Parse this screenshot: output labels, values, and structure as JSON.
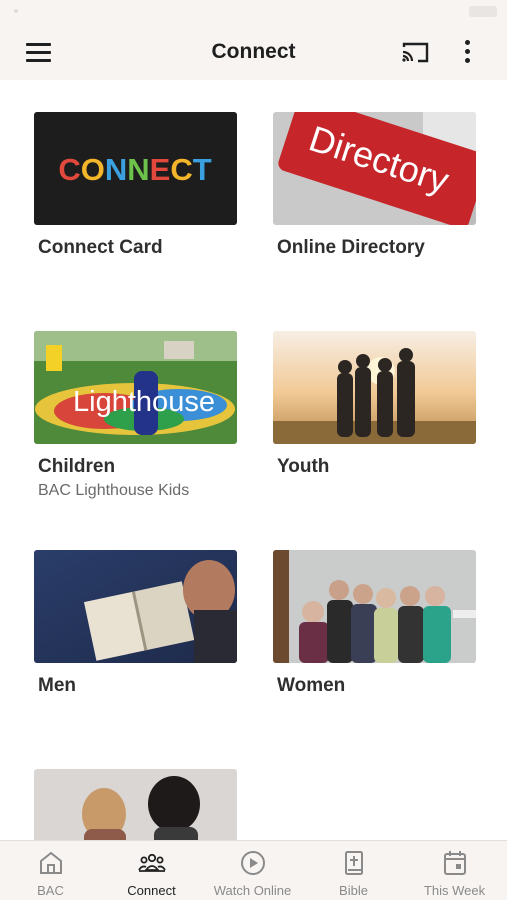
{
  "header": {
    "title": "Connect"
  },
  "cards": [
    {
      "label": "Connect Card",
      "image_text": "CONNECT"
    },
    {
      "label": "Online Directory",
      "image_text": "Directory"
    },
    {
      "label": "Children",
      "subtitle": "BAC Lighthouse Kids",
      "image_text": "Lighthouse"
    },
    {
      "label": "Youth"
    },
    {
      "label": "Men"
    },
    {
      "label": "Women"
    }
  ],
  "tabs": [
    {
      "label": "BAC",
      "icon": "home-icon"
    },
    {
      "label": "Connect",
      "icon": "people-icon",
      "active": true
    },
    {
      "label": "Watch Online",
      "icon": "play-circle-icon"
    },
    {
      "label": "Bible",
      "icon": "bible-icon"
    },
    {
      "label": "This Week",
      "icon": "calendar-icon"
    }
  ],
  "colors": {
    "header_bg": "#f7f4f2",
    "active_tab": "#222222",
    "inactive_tab": "#8a8a8a"
  }
}
